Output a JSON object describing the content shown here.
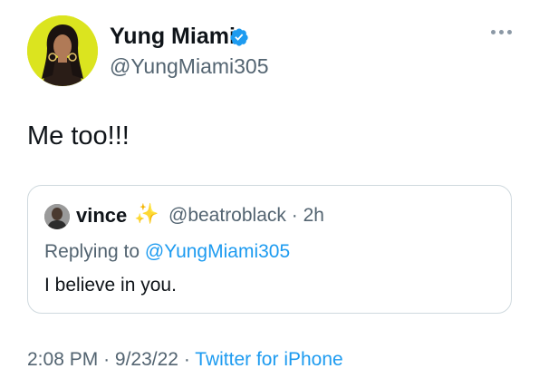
{
  "tweet": {
    "display_name": "Yung Miami",
    "handle": "@YungMiami305",
    "text": "Me too!!!",
    "verified": true,
    "more_icon": "more-horizontal-icon"
  },
  "quoted": {
    "display_name": "vince",
    "sparkles": "✨",
    "handle": "@beatroblack",
    "separator": "·",
    "time": "2h",
    "replying_prefix": "Replying to ",
    "replying_handle": "@YungMiami305",
    "text": "I believe in you."
  },
  "meta": {
    "time": "2:08 PM",
    "separator": "·",
    "date": "9/23/22",
    "source": "Twitter for iPhone"
  },
  "colors": {
    "accent": "#1d9bf0",
    "verified_badge": "#1d9bf0",
    "secondary_text": "#536471",
    "border": "#cfd9de"
  }
}
